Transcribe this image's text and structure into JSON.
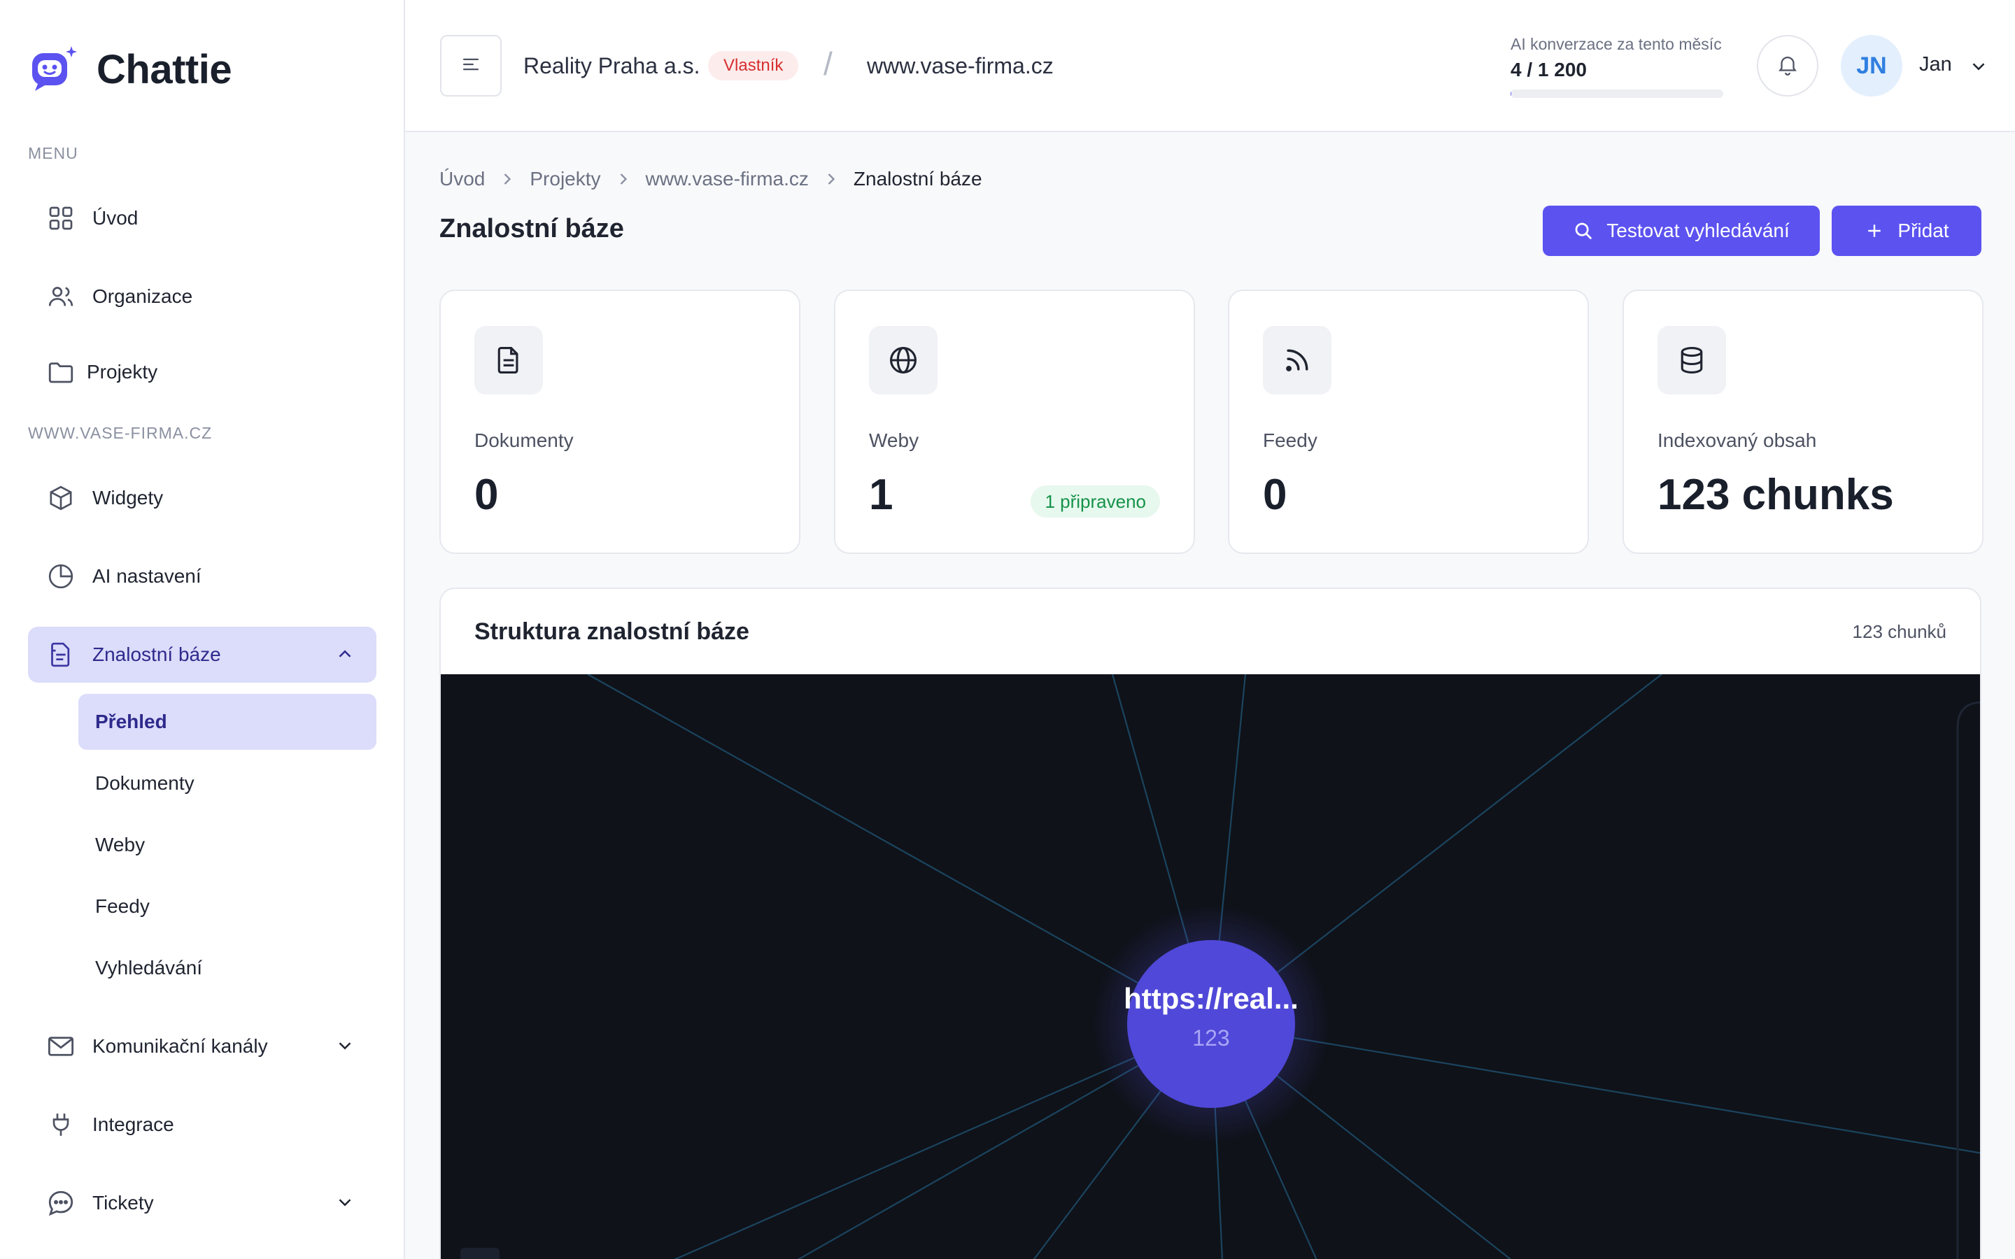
{
  "app": {
    "name": "Chattie"
  },
  "sidebar": {
    "menu_label": "MENU",
    "project_label": "WWW.VASE-FIRMA.CZ",
    "items": [
      {
        "label": "Úvod",
        "icon": "grid-icon"
      },
      {
        "label": "Organizace",
        "icon": "users-icon"
      },
      {
        "label": "Projekty",
        "icon": "folder-icon"
      },
      {
        "label": "Widgety",
        "icon": "cube-icon"
      },
      {
        "label": "AI nastavení",
        "icon": "pie-chart-icon"
      },
      {
        "label": "Znalostní báze",
        "icon": "document-icon",
        "active": true
      },
      {
        "label": "Komunikační kanály",
        "icon": "mail-icon"
      },
      {
        "label": "Integrace",
        "icon": "plug-icon"
      },
      {
        "label": "Tickety",
        "icon": "chat-bubble-icon"
      }
    ],
    "subitems": [
      {
        "label": "Přehled",
        "active": true
      },
      {
        "label": "Dokumenty"
      },
      {
        "label": "Weby"
      },
      {
        "label": "Feedy"
      },
      {
        "label": "Vyhledávání"
      }
    ]
  },
  "header": {
    "org_name": "Reality Praha a.s.",
    "role_badge": "Vlastník",
    "separator": "/",
    "site": "www.vase-firma.cz",
    "usage_label": "AI konverzace za tento měsíc",
    "usage_value": "4 / 1 200",
    "usage_fraction": 0.0033,
    "avatar_initials": "JN",
    "user_name": "Jan"
  },
  "breadcrumb": [
    "Úvod",
    "Projekty",
    "www.vase-firma.cz",
    "Znalostní báze"
  ],
  "page": {
    "title": "Znalostní báze",
    "test_button": "Testovat vyhledávání",
    "add_button": "Přidat"
  },
  "stats": [
    {
      "label": "Dokumenty",
      "value": "0",
      "icon": "file-text-icon"
    },
    {
      "label": "Weby",
      "value": "1",
      "icon": "globe-icon",
      "badge": "1 připraveno"
    },
    {
      "label": "Feedy",
      "value": "0",
      "icon": "rss-icon"
    },
    {
      "label": "Indexovaný obsah",
      "value": "123 chunks",
      "icon": "database-icon"
    }
  ],
  "structure": {
    "title": "Struktura znalostní báze",
    "count": "123 chunků",
    "node_label": "https://real...",
    "node_count": "123"
  },
  "colors": {
    "accent": "#5b52f0",
    "badge_red": "#d62f2f",
    "badge_green": "#16924a",
    "graph_bg": "#0f1219"
  }
}
